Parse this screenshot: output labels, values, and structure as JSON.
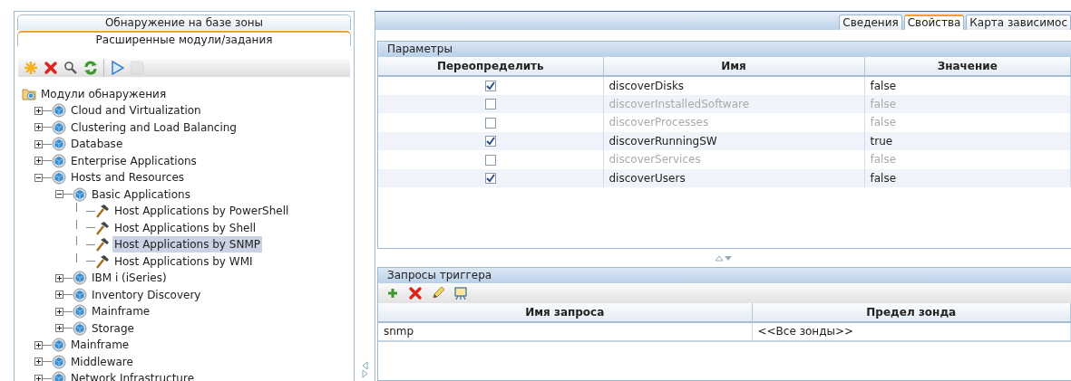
{
  "left_tabs": [
    {
      "label": "Обнаружение на базе зоны",
      "selected": false
    },
    {
      "label": "Расширенные модули/задания",
      "selected": true
    }
  ],
  "left_toolbar": [
    {
      "kind": "new",
      "disabled": false
    },
    {
      "kind": "delete",
      "disabled": false
    },
    {
      "kind": "search",
      "disabled": false
    },
    {
      "kind": "refresh",
      "disabled": false
    },
    {
      "kind": "separator"
    },
    {
      "kind": "run",
      "disabled": false
    },
    {
      "kind": "stop",
      "disabled": true
    }
  ],
  "tree": {
    "label": "Модули обнаружения",
    "kind": "root",
    "children": [
      {
        "label": "Cloud and Virtualization",
        "kind": "group",
        "expanded": false,
        "selected": false
      },
      {
        "label": "Clustering and Load Balancing",
        "kind": "group",
        "expanded": false,
        "selected": false
      },
      {
        "label": "Database",
        "kind": "group",
        "expanded": false,
        "selected": false
      },
      {
        "label": "Enterprise Applications",
        "kind": "group",
        "expanded": false,
        "selected": false
      },
      {
        "label": "Hosts and Resources",
        "kind": "group",
        "expanded": true,
        "selected": false,
        "children": [
          {
            "label": "Basic Applications",
            "kind": "group",
            "expanded": true,
            "selected": false,
            "children": [
              {
                "label": "Host Applications by PowerShell",
                "kind": "job",
                "selected": false
              },
              {
                "label": "Host Applications by Shell",
                "kind": "job",
                "selected": false
              },
              {
                "label": "Host Applications by SNMP",
                "kind": "job",
                "selected": true
              },
              {
                "label": "Host Applications by WMI",
                "kind": "job",
                "selected": false
              }
            ]
          },
          {
            "label": "IBM i (iSeries)",
            "kind": "group",
            "expanded": false,
            "selected": false
          },
          {
            "label": "Inventory Discovery",
            "kind": "group",
            "expanded": false,
            "selected": false
          },
          {
            "label": "Mainframe",
            "kind": "group",
            "expanded": false,
            "selected": false
          },
          {
            "label": "Storage",
            "kind": "group",
            "expanded": false,
            "selected": false
          }
        ]
      },
      {
        "label": "Mainframe",
        "kind": "group",
        "expanded": false,
        "selected": false
      },
      {
        "label": "Middleware",
        "kind": "group",
        "expanded": false,
        "selected": false
      },
      {
        "label": "Network Infrastructure",
        "kind": "group",
        "expanded": false,
        "selected": false
      }
    ]
  },
  "right_tabs": [
    {
      "label": "Сведения",
      "selected": false
    },
    {
      "label": "Свойства",
      "selected": true
    },
    {
      "label": "Карта зависимос",
      "selected": false
    }
  ],
  "parameters": {
    "title": "Параметры",
    "columns": [
      "Переопределить",
      "Имя",
      "Значение"
    ],
    "rows": [
      {
        "checked": true,
        "name": "discoverDisks",
        "value": "false"
      },
      {
        "checked": false,
        "name": "discoverInstalledSoftware",
        "value": "false"
      },
      {
        "checked": false,
        "name": "discoverProcesses",
        "value": "false"
      },
      {
        "checked": true,
        "name": "discoverRunningSW",
        "value": "true"
      },
      {
        "checked": false,
        "name": "discoverServices",
        "value": "false"
      },
      {
        "checked": true,
        "name": "discoverUsers",
        "value": "false"
      }
    ]
  },
  "triggers": {
    "title": "Запросы триггера",
    "toolbar": [
      {
        "kind": "add"
      },
      {
        "kind": "delete"
      },
      {
        "kind": "edit"
      },
      {
        "kind": "preview"
      }
    ],
    "columns": [
      "Имя запроса",
      "Предел зонда"
    ],
    "rows": [
      [
        "snmp",
        "<<Все зонды>>"
      ]
    ]
  }
}
